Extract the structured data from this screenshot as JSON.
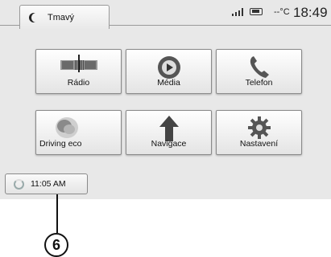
{
  "header": {
    "tab_label": "Tmavý",
    "temperature": "--°C",
    "clock": "18:49"
  },
  "tiles": [
    {
      "label": "Rádio",
      "icon": "radio-icon"
    },
    {
      "label": "Média",
      "icon": "media-play-icon"
    },
    {
      "label": "Telefon",
      "icon": "phone-icon"
    },
    {
      "label": "Driving eco",
      "icon": "eco-leaf-icon"
    },
    {
      "label": "Navigace",
      "icon": "navigation-arrow-icon"
    },
    {
      "label": "Nastavení",
      "icon": "gear-icon"
    }
  ],
  "footer": {
    "time": "11:05 AM"
  },
  "callout": {
    "number": "6"
  }
}
